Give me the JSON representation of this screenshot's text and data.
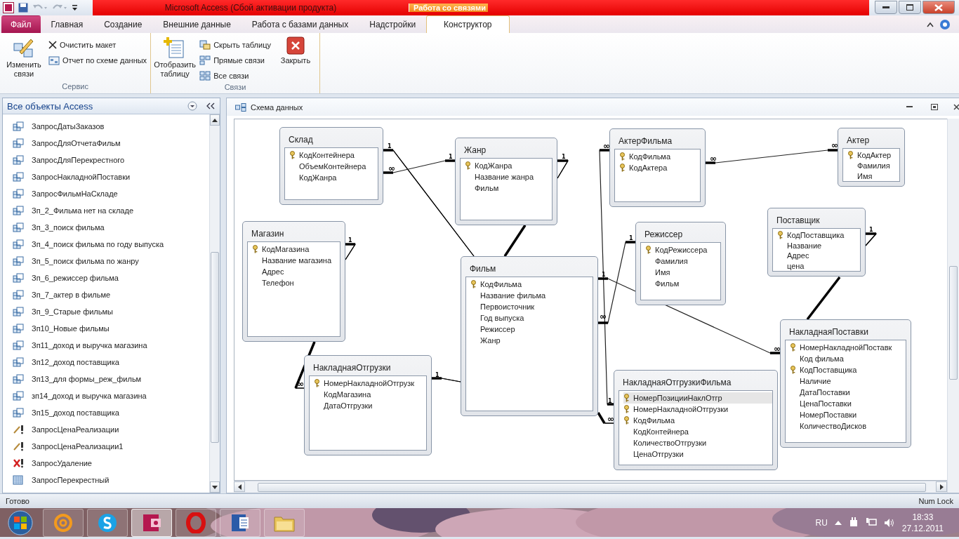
{
  "title_bar": {
    "title": "Microsoft Access (Сбой активации продукта)",
    "context_group": "Работа со связями"
  },
  "ribbon_tabs": [
    {
      "label": "Файл",
      "kind": "file",
      "selected": false
    },
    {
      "label": "Главная",
      "kind": "tab",
      "selected": false
    },
    {
      "label": "Создание",
      "kind": "tab",
      "selected": false
    },
    {
      "label": "Внешние данные",
      "kind": "tab",
      "selected": false
    },
    {
      "label": "Работа с базами данных",
      "kind": "tab",
      "selected": false
    },
    {
      "label": "Надстройки",
      "kind": "tab",
      "selected": false
    },
    {
      "label": "Конструктор",
      "kind": "tab",
      "selected": true
    }
  ],
  "ribbon_groups": [
    {
      "label": "Сервис",
      "buttons": [
        {
          "label": "Изменить связи",
          "kind": "large"
        },
        {
          "label": "Очистить макет",
          "kind": "small"
        },
        {
          "label": "Отчет по схеме данных",
          "kind": "small"
        }
      ]
    },
    {
      "label": "Связи",
      "buttons": [
        {
          "label": "Отобразить таблицу",
          "kind": "large"
        },
        {
          "label": "Скрыть таблицу",
          "kind": "small"
        },
        {
          "label": "Прямые связи",
          "kind": "small"
        },
        {
          "label": "Все связи",
          "kind": "small"
        },
        {
          "label": "Закрыть",
          "kind": "large"
        }
      ]
    }
  ],
  "navigation": {
    "title": "Все объекты Access",
    "items": [
      {
        "label": "ЗапросДатыЗаказов",
        "kind": "select"
      },
      {
        "label": "ЗапросДляОтчетаФильм",
        "kind": "select"
      },
      {
        "label": "ЗапросДляПерекрестного",
        "kind": "select"
      },
      {
        "label": "ЗапросНакладнойПоставки",
        "kind": "select"
      },
      {
        "label": "ЗапросФильмНаСкладе",
        "kind": "select"
      },
      {
        "label": "Зп_2_Фильма нет на складе",
        "kind": "select"
      },
      {
        "label": "Зп_3_поиск фильма",
        "kind": "select"
      },
      {
        "label": "Зп_4_поиск фильма по году выпуска",
        "kind": "select"
      },
      {
        "label": "Зп_5_поиск фильма по жанру",
        "kind": "select"
      },
      {
        "label": "Зп_6_режиссер фильма",
        "kind": "select"
      },
      {
        "label": "Зп_7_актер в фильме",
        "kind": "select"
      },
      {
        "label": "Зп_9_Старые фильмы",
        "kind": "select"
      },
      {
        "label": "Зп10_Новые фильмы",
        "kind": "select"
      },
      {
        "label": "Зп11_доход и выручка магазина",
        "kind": "select"
      },
      {
        "label": "Зп12_доход поставщика",
        "kind": "select"
      },
      {
        "label": "Зп13_для формы_реж_фильм",
        "kind": "select"
      },
      {
        "label": "зп14_доход и выручка магазина",
        "kind": "select"
      },
      {
        "label": "Зп15_доход поставщика",
        "kind": "select"
      },
      {
        "label": "ЗапросЦенаРеализации",
        "kind": "update"
      },
      {
        "label": "ЗапросЦенаРеализации1",
        "kind": "update"
      },
      {
        "label": "ЗапросУдаление",
        "kind": "delete"
      },
      {
        "label": "ЗапросПерекрестный",
        "kind": "crosstab"
      }
    ]
  },
  "document": {
    "title": "Схема данных",
    "tables": [
      {
        "name": "Склад",
        "fields": [
          {
            "name": "КодКонтейнера",
            "key": true
          },
          {
            "name": "ОбъемКонтейнера",
            "key": false
          },
          {
            "name": "КодЖанра",
            "key": false
          }
        ]
      },
      {
        "name": "Жанр",
        "fields": [
          {
            "name": "КодЖанра",
            "key": true
          },
          {
            "name": "Название жанра",
            "key": false
          },
          {
            "name": "Фильм",
            "key": false
          }
        ]
      },
      {
        "name": "АктерФильма",
        "fields": [
          {
            "name": "КодФильма",
            "key": true
          },
          {
            "name": "КодАктера",
            "key": true
          }
        ]
      },
      {
        "name": "Актер",
        "fields": [
          {
            "name": "КодАктер",
            "key": true
          },
          {
            "name": "Фамилия",
            "key": false
          },
          {
            "name": "Имя",
            "key": false
          }
        ]
      },
      {
        "name": "Магазин",
        "fields": [
          {
            "name": "КодМагазина",
            "key": true
          },
          {
            "name": "Название магазина",
            "key": false
          },
          {
            "name": "Адрес",
            "key": false
          },
          {
            "name": "Телефон",
            "key": false
          }
        ]
      },
      {
        "name": "Режиссер",
        "fields": [
          {
            "name": "КодРежиссера",
            "key": true
          },
          {
            "name": "Фамилия",
            "key": false
          },
          {
            "name": "Имя",
            "key": false
          },
          {
            "name": "Фильм",
            "key": false
          }
        ]
      },
      {
        "name": "Поставщик",
        "fields": [
          {
            "name": "КодПоставщика",
            "key": true
          },
          {
            "name": "Название",
            "key": false
          },
          {
            "name": "Адрес",
            "key": false
          },
          {
            "name": "цена",
            "key": false
          }
        ]
      },
      {
        "name": "Фильм",
        "fields": [
          {
            "name": "КодФильма",
            "key": true
          },
          {
            "name": "Название фильма",
            "key": false
          },
          {
            "name": "Первоисточник",
            "key": false
          },
          {
            "name": "Год выпуска",
            "key": false
          },
          {
            "name": "Режиссер",
            "key": false
          },
          {
            "name": "Жанр",
            "key": false
          }
        ]
      },
      {
        "name": "НакладнаяОтгрузки",
        "fields": [
          {
            "name": "НомерНакладнойОтгрузк",
            "key": true
          },
          {
            "name": "КодМагазина",
            "key": false
          },
          {
            "name": "ДатаОтгрузки",
            "key": false
          }
        ]
      },
      {
        "name": "НакладнаяОтгрузкиФильма",
        "fields": [
          {
            "name": "НомерПозицииНаклОтгр",
            "key": true,
            "selected": true
          },
          {
            "name": "НомерНакладнойОтгрузки",
            "key": true,
            "selected": false
          },
          {
            "name": "КодФильма",
            "key": true,
            "selected": false
          },
          {
            "name": "КодКонтейнера",
            "key": false,
            "selected": false
          },
          {
            "name": "КоличествоОтгрузки",
            "key": false,
            "selected": false
          },
          {
            "name": "ЦенаОтгрузки",
            "key": false,
            "selected": false
          }
        ]
      },
      {
        "name": "НакладнаяПоставки",
        "fields": [
          {
            "name": "НомерНакладнойПоставк",
            "key": true
          },
          {
            "name": "Код фильма",
            "key": false
          },
          {
            "name": "КодПоставщика",
            "key": true
          },
          {
            "name": "Наличие",
            "key": false
          },
          {
            "name": "ДатаПоставки",
            "key": false
          },
          {
            "name": "ЦенаПоставки",
            "key": false
          },
          {
            "name": "НомерПоставки",
            "key": false
          },
          {
            "name": "КоличествоДисков",
            "key": false
          }
        ]
      }
    ],
    "relationships": [
      {
        "marks": [
          "1"
        ]
      },
      {
        "marks": [
          "∞",
          "1"
        ]
      },
      {
        "marks": [
          "1"
        ]
      },
      {
        "marks": [
          "∞",
          "1"
        ]
      },
      {
        "marks": [
          "∞",
          "∞"
        ]
      },
      {
        "marks": [
          "1",
          "∞"
        ]
      },
      {
        "marks": [
          "1",
          "∞"
        ]
      },
      {
        "marks": [
          "1"
        ]
      },
      {
        "marks": [
          "∞"
        ]
      },
      {
        "marks": [
          "1",
          "∞"
        ]
      },
      {
        "marks": [
          "1"
        ]
      }
    ]
  },
  "status_bar": {
    "left": "Готово",
    "right": "Num Lock"
  },
  "taskbar": {
    "apps": [
      {
        "kind": "mail",
        "active": false
      },
      {
        "kind": "skype",
        "active": false
      },
      {
        "kind": "access",
        "active": true
      },
      {
        "kind": "opera",
        "active": false
      },
      {
        "kind": "word",
        "active": false
      },
      {
        "kind": "explorer",
        "active": false
      }
    ],
    "language": "RU",
    "time": "18:33",
    "date": "27.12.2011"
  }
}
